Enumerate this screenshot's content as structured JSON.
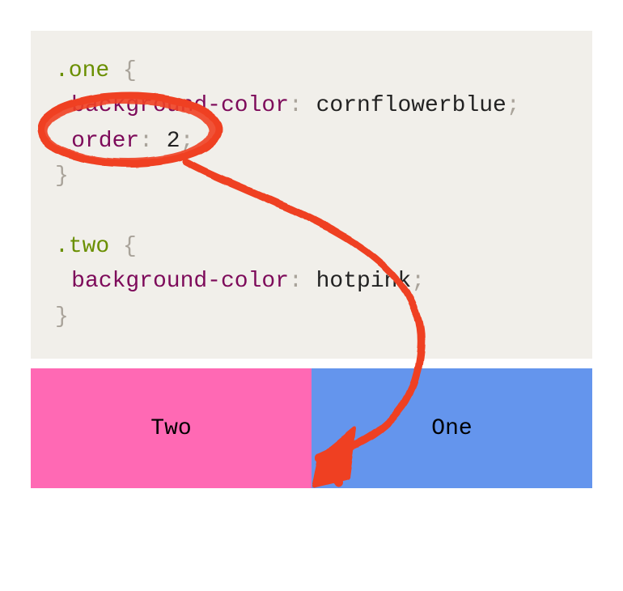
{
  "code": {
    "rule1": {
      "selector": ".one",
      "open_brace": "{",
      "prop_bg": "background-color",
      "val_bg": "cornflowerblue",
      "prop_order": "order",
      "val_order": "2",
      "close_brace": "}"
    },
    "rule2": {
      "selector": ".two",
      "open_brace": "{",
      "prop_bg": "background-color",
      "val_bg": "hotpink",
      "close_brace": "}"
    },
    "colon": ":",
    "semicolon": ";",
    "space": " "
  },
  "demo": {
    "left_label": "Two",
    "right_label": "One"
  },
  "colors": {
    "code_bg": "#f1efea",
    "annotation": "#ef4123",
    "two_bg": "hotpink (#ff69b4)",
    "one_bg": "cornflowerblue (#6495ed)"
  }
}
